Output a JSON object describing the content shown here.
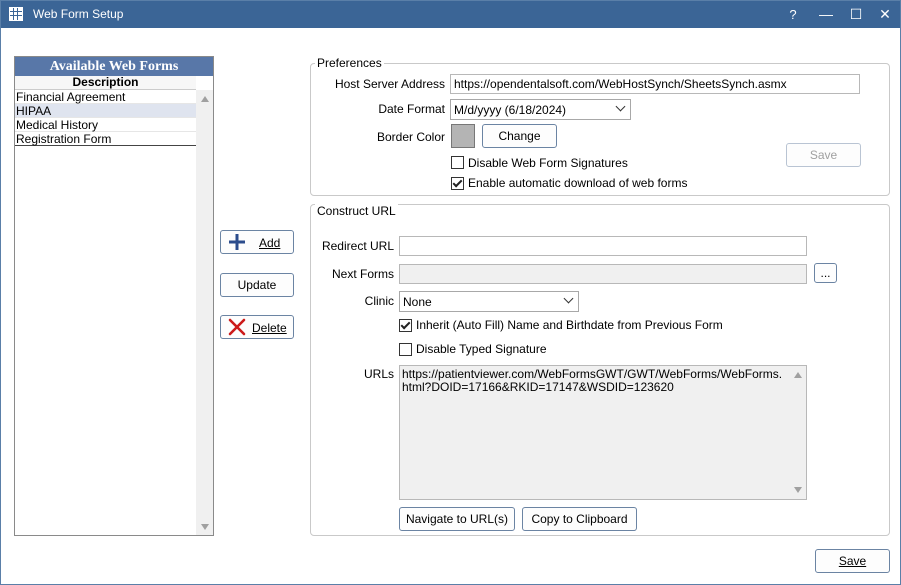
{
  "window": {
    "title": "Web Form Setup",
    "help_glyph": "?",
    "minimize_glyph": "—",
    "maximize_glyph": "☐",
    "close_glyph": "✕"
  },
  "forms_list": {
    "header": "Available Web Forms",
    "column": "Description",
    "items": [
      {
        "label": "Financial Agreement",
        "selected": false
      },
      {
        "label": "HIPAA",
        "selected": true
      },
      {
        "label": "Medical History",
        "selected": false
      },
      {
        "label": "Registration Form",
        "selected": false
      }
    ]
  },
  "actions": {
    "add_label": "Add",
    "update_label": "Update",
    "delete_label": "Delete"
  },
  "preferences": {
    "title": "Preferences",
    "host_label": "Host Server Address",
    "host_value": "https://opendentalsoft.com/WebHostSynch/SheetsSynch.asmx",
    "date_label": "Date Format",
    "date_value": "M/d/yyyy (6/18/2024)",
    "border_label": "Border Color",
    "border_color": "#b4b4b4",
    "change_label": "Change",
    "save_label": "Save",
    "disable_sig_label": "Disable Web Form Signatures",
    "disable_sig_checked": false,
    "auto_download_label": "Enable automatic download of web forms",
    "auto_download_checked": true
  },
  "construct": {
    "title": "Construct URL",
    "redirect_label": "Redirect URL",
    "redirect_value": "",
    "next_label": "Next Forms",
    "next_value": "",
    "ellipsis_label": "...",
    "clinic_label": "Clinic",
    "clinic_value": "None",
    "inherit_label": "Inherit (Auto Fill) Name and Birthdate from Previous Form",
    "inherit_checked": true,
    "typed_sig_label": "Disable Typed Signature",
    "typed_sig_checked": false,
    "urls_label": "URLs",
    "urls_value": "https://patientviewer.com/WebFormsGWT/GWT/WebForms/WebForms.html?DOID=17166&RKID=17147&WSDID=123620",
    "navigate_label": "Navigate to URL(s)",
    "copy_label": "Copy to Clipboard"
  },
  "footer": {
    "save_label": "Save"
  },
  "colors": {
    "titlebar": "#3b6596",
    "list_header": "#5877a8",
    "add_icon": "#2b4c8c",
    "delete_icon": "#cc1a1a"
  }
}
